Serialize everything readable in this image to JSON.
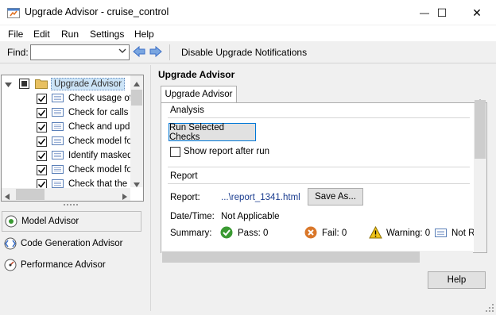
{
  "window": {
    "title": "Upgrade Advisor - cruise_control",
    "minimize_glyph": "—",
    "maximize_glyph": "☐",
    "close_glyph": "✕"
  },
  "menu": [
    "File",
    "Edit",
    "Run",
    "Settings",
    "Help"
  ],
  "toolbar": {
    "find_label": "Find:",
    "find_value": "",
    "disable_label": "Disable Upgrade Notifications"
  },
  "tree": {
    "root_label": "Upgrade Advisor",
    "items": [
      {
        "label": "Check usage of"
      },
      {
        "label": "Check for calls t"
      },
      {
        "label": "Check and upda"
      },
      {
        "label": "Check model for"
      },
      {
        "label": "Identify masked"
      },
      {
        "label": "Check model for"
      },
      {
        "label": "Check that the r"
      }
    ]
  },
  "advisors": [
    {
      "label": "Model Advisor",
      "icon": "model-advisor-icon"
    },
    {
      "label": "Code Generation Advisor",
      "icon": "code-gen-advisor-icon"
    },
    {
      "label": "Performance Advisor",
      "icon": "performance-advisor-icon"
    }
  ],
  "main": {
    "title": "Upgrade Advisor",
    "tab_label": "Upgrade Advisor",
    "analysis_label": "Analysis",
    "run_button": "Run Selected Checks",
    "show_report_label": "Show report after run",
    "report_section": "Report",
    "report_label": "Report:",
    "report_link": "...\\report_1341.html",
    "save_as_button": "Save As...",
    "datetime_label": "Date/Time:",
    "datetime_value": "Not Applicable",
    "summary_label": "Summary:",
    "pass_text": "Pass: 0",
    "fail_text": "Fail: 0",
    "warning_text": "Warning: 0",
    "not_run_text": "Not Ru"
  },
  "footer": {
    "help_button": "Help"
  },
  "colors": {
    "pass": "#3a9a32",
    "fail": "#d9772a",
    "warning": "#f0c419",
    "folder": "#e8c060",
    "arrow_blue": "#3b6fc7"
  }
}
